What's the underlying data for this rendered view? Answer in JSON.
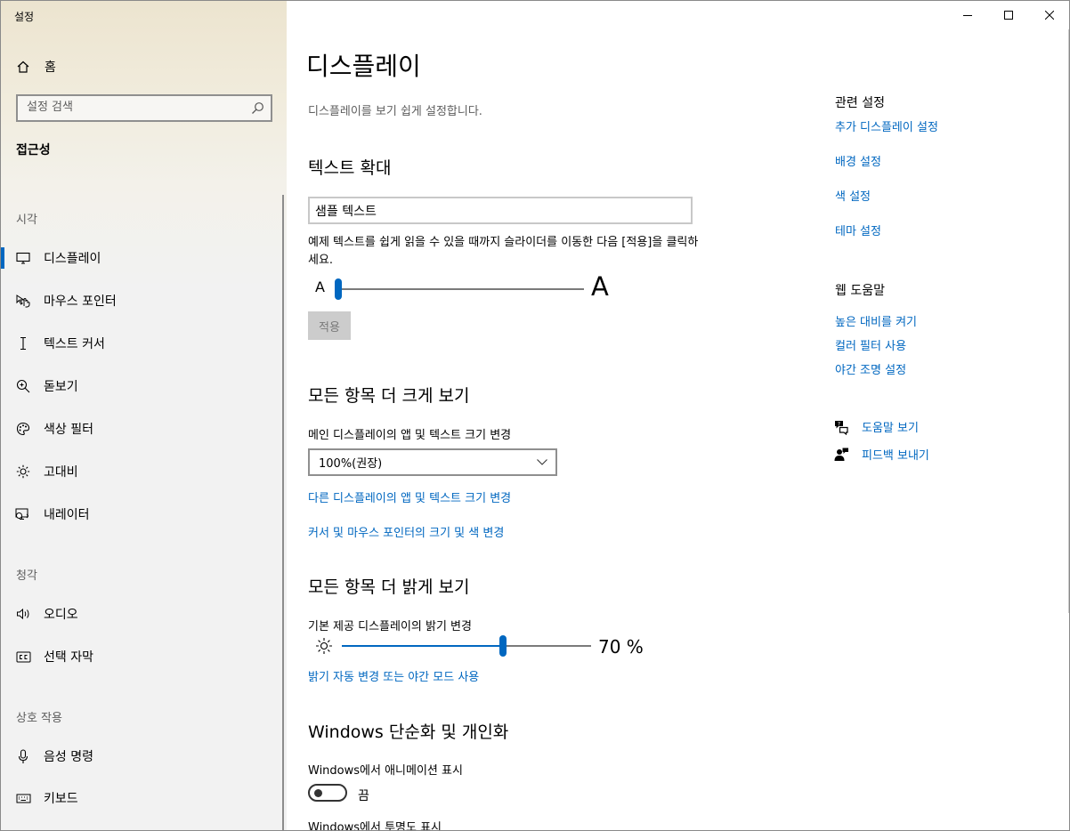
{
  "app": {
    "title": "설정"
  },
  "sidebar": {
    "home_label": "홈",
    "search_placeholder": "설정 검색",
    "category": "접근성",
    "groups": [
      {
        "label": "시각"
      },
      {
        "label": "청각"
      },
      {
        "label": "상호 작용"
      }
    ],
    "items": [
      {
        "label": "디스플레이",
        "icon": "monitor-icon",
        "active": true
      },
      {
        "label": "마우스 포인터",
        "icon": "mouse-pointer-icon"
      },
      {
        "label": "텍스트 커서",
        "icon": "text-cursor-icon"
      },
      {
        "label": "돋보기",
        "icon": "magnifier-icon"
      },
      {
        "label": "색상 필터",
        "icon": "palette-icon"
      },
      {
        "label": "고대비",
        "icon": "sun-icon"
      },
      {
        "label": "내레이터",
        "icon": "narrator-icon"
      },
      {
        "label": "오디오",
        "icon": "speaker-icon"
      },
      {
        "label": "선택 자막",
        "icon": "caption-icon"
      },
      {
        "label": "음성 명령",
        "icon": "microphone-icon"
      },
      {
        "label": "키보드",
        "icon": "keyboard-icon"
      }
    ]
  },
  "main": {
    "title": "디스플레이",
    "description": "디스플레이를 보기 쉽게 설정합니다.",
    "text_size": {
      "heading": "텍스트 확대",
      "sample": "샘플 텍스트",
      "note": "예제 텍스트를 쉽게 읽을 수 있을 때까지 슬라이더를 이동한 다음 [적용]을 클릭하세요.",
      "small_a": "A",
      "big_a": "A",
      "slider_value": 0,
      "apply_label": "적용"
    },
    "bigger": {
      "heading": "모든 항목 더 크게 보기",
      "label": "메인 디스플레이의 앱 및 텍스트 크기 변경",
      "selected": "100%(권장)",
      "link1": "다른 디스플레이의 앱 및 텍스트 크기 변경",
      "link2": "커서 및 마우스 포인터의 크기 및 색 변경"
    },
    "brighter": {
      "heading": "모든 항목 더 밝게 보기",
      "label": "기본 제공 디스플레이의 밝기 변경",
      "value": 70,
      "value_text": "70 %",
      "link": "밝기 자동 변경 또는 야간 모드 사용"
    },
    "simplify": {
      "heading": "Windows 단순화 및 개인화",
      "animation_label": "Windows에서 애니메이션 표시",
      "animation_state": "끔",
      "transparency_label": "Windows에서 투명도 표시"
    }
  },
  "related": {
    "heading": "관련 설정",
    "links": [
      "추가 디스플레이 설정",
      "배경 설정",
      "색 설정",
      "테마 설정"
    ]
  },
  "web_help": {
    "heading": "웹 도움말",
    "links": [
      "높은 대비를 켜기",
      "컬러 필터 사용",
      "야간 조명 설정"
    ]
  },
  "support": {
    "help": "도움말 보기",
    "feedback": "피드백 보내기"
  },
  "colors": {
    "accent": "#0067c0"
  }
}
